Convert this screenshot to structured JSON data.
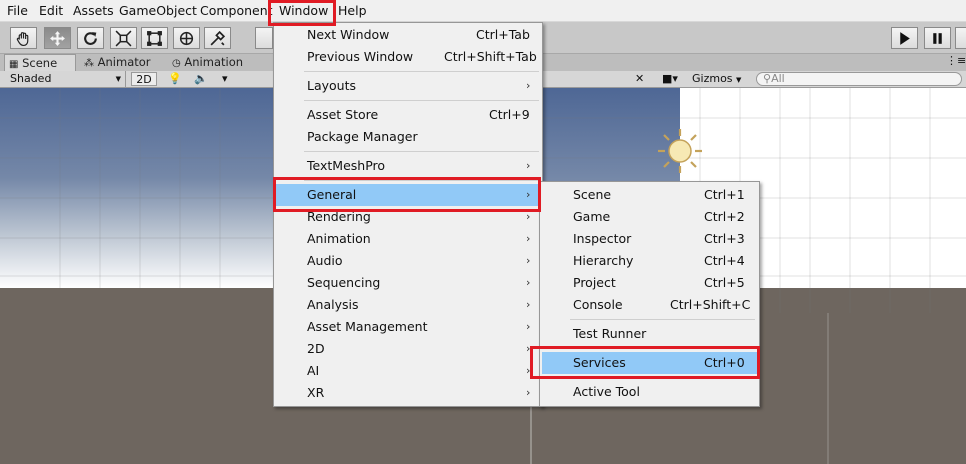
{
  "menubar": [
    "File",
    "Edit",
    "Assets",
    "GameObject",
    "Component",
    "Window",
    "Help"
  ],
  "tabs": {
    "scene": "Scene",
    "animator": "Animator",
    "animation": "Animation"
  },
  "scene_bar": {
    "shading": "Shaded",
    "mode_2d": "2D",
    "gizmos": "Gizmos",
    "search_placeholder": "All"
  },
  "window_menu": {
    "next_window": {
      "label": "Next Window",
      "shortcut": "Ctrl+Tab"
    },
    "previous_window": {
      "label": "Previous Window",
      "shortcut": "Ctrl+Shift+Tab"
    },
    "layouts": {
      "label": "Layouts"
    },
    "asset_store": {
      "label": "Asset Store",
      "shortcut": "Ctrl+9"
    },
    "package_manager": {
      "label": "Package Manager"
    },
    "textmeshpro": {
      "label": "TextMeshPro"
    },
    "general": {
      "label": "General"
    },
    "rendering": {
      "label": "Rendering"
    },
    "animation": {
      "label": "Animation"
    },
    "audio": {
      "label": "Audio"
    },
    "sequencing": {
      "label": "Sequencing"
    },
    "analysis": {
      "label": "Analysis"
    },
    "asset_management": {
      "label": "Asset Management"
    },
    "twod": {
      "label": "2D"
    },
    "ai": {
      "label": "AI"
    },
    "xr": {
      "label": "XR"
    }
  },
  "general_menu": {
    "scene": {
      "label": "Scene",
      "shortcut": "Ctrl+1"
    },
    "game": {
      "label": "Game",
      "shortcut": "Ctrl+2"
    },
    "inspector": {
      "label": "Inspector",
      "shortcut": "Ctrl+3"
    },
    "hierarchy": {
      "label": "Hierarchy",
      "shortcut": "Ctrl+4"
    },
    "project": {
      "label": "Project",
      "shortcut": "Ctrl+5"
    },
    "console": {
      "label": "Console",
      "shortcut": "Ctrl+Shift+C"
    },
    "test_runner": {
      "label": "Test Runner"
    },
    "services": {
      "label": "Services",
      "shortcut": "Ctrl+0"
    },
    "active_tool": {
      "label": "Active Tool"
    }
  },
  "colors": {
    "highlight": "#91c9f7",
    "callout": "#e01b24"
  }
}
